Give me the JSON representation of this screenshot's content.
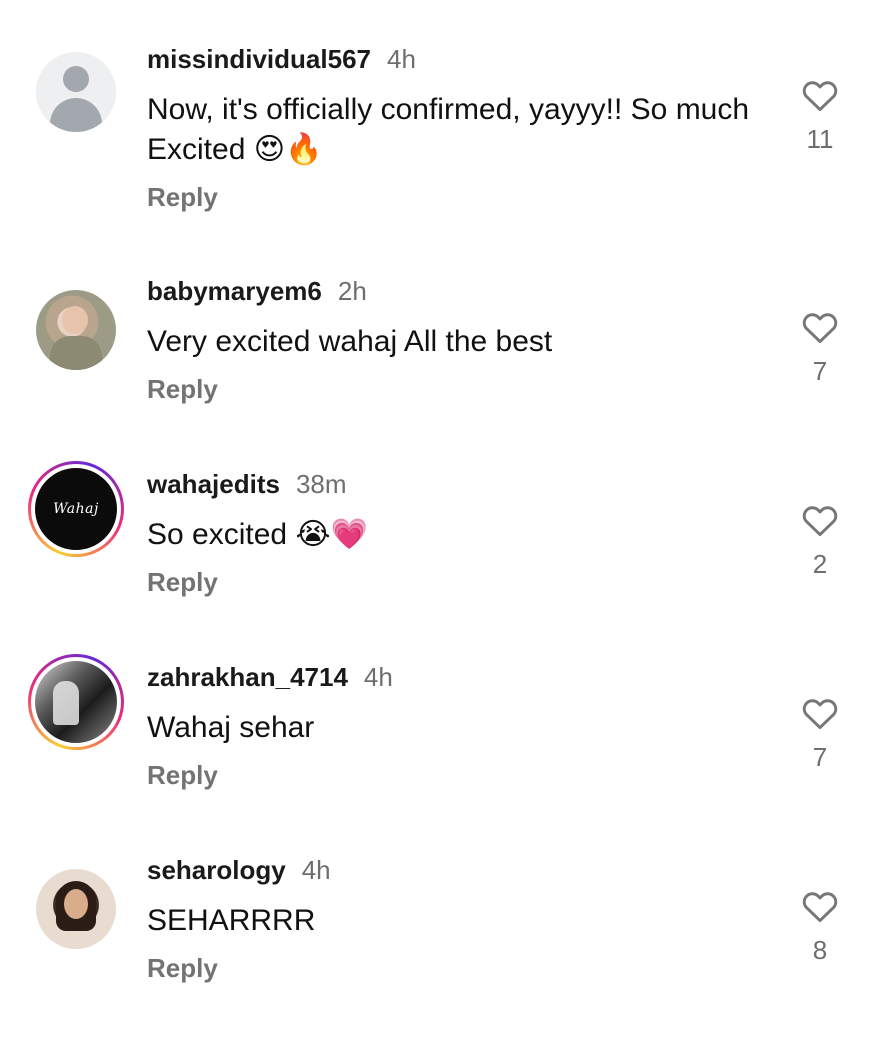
{
  "comments": [
    {
      "username": "missindividual567",
      "time": "4h",
      "text": "Now, it's officially confirmed, yayyy!! So much Excited",
      "emoji": "😍🔥",
      "reply_label": "Reply",
      "likes": "11",
      "avatar": "default-avatar-icon"
    },
    {
      "username": "babymaryem6",
      "time": "2h",
      "text": "Very excited wahaj All the best",
      "emoji": "",
      "reply_label": "Reply",
      "likes": "7",
      "avatar": "photo"
    },
    {
      "username": "wahajedits",
      "time": "38m",
      "text": "So excited",
      "emoji": "😭💗",
      "reply_label": "Reply",
      "likes": "2",
      "avatar": "logo",
      "avatar_text": "Wahaj"
    },
    {
      "username": "zahrakhan_4714",
      "time": "4h",
      "text": "Wahaj sehar",
      "emoji": "",
      "reply_label": "Reply",
      "likes": "7",
      "avatar": "photo"
    },
    {
      "username": "seharology",
      "time": "4h",
      "text": "SEHARRRR",
      "emoji": "",
      "reply_label": "Reply",
      "likes": "8",
      "avatar": "photo"
    }
  ],
  "colors": {
    "username": "#1a1a1a",
    "meta": "#6e6e6e",
    "story_ring_start": "#f9ce34",
    "story_ring_mid": "#ee2a7b"
  },
  "icons": {
    "like": "heart-outline-icon"
  }
}
